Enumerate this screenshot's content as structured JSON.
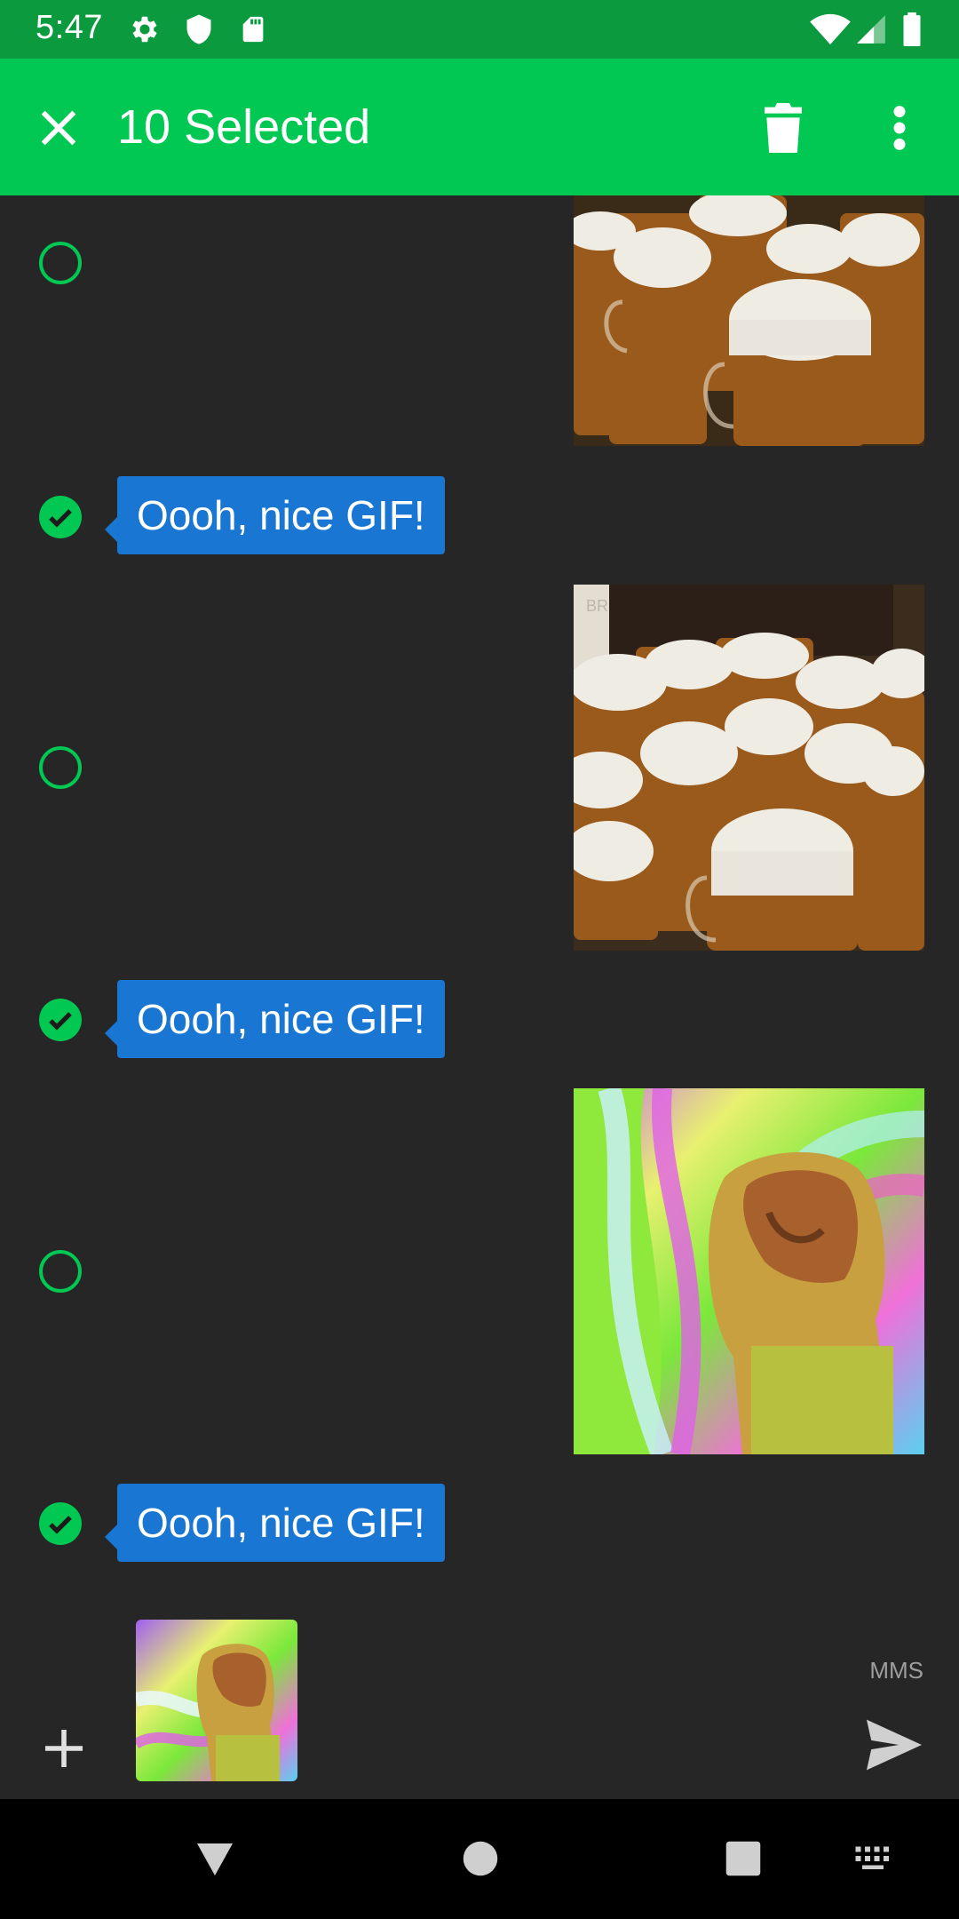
{
  "status_bar": {
    "time": "5:47",
    "icons": [
      "settings-gear-icon",
      "shield-icon",
      "sd-card-icon",
      "wifi-icon",
      "cellular-signal-icon",
      "battery-icon"
    ]
  },
  "toolbar": {
    "close_icon": "close-icon",
    "title": "10 Selected",
    "delete_icon": "trash-icon",
    "more_icon": "more-vert-icon"
  },
  "messages": [
    {
      "type": "image",
      "subject": "beer mugs gif",
      "selected": false
    },
    {
      "type": "text",
      "text": "Oooh, nice GIF!",
      "selected": true
    },
    {
      "type": "image",
      "subject": "beer mugs gif",
      "selected": false
    },
    {
      "type": "text",
      "text": "Oooh, nice GIF!",
      "selected": true
    },
    {
      "type": "image",
      "subject": "psychedelic hand gif",
      "selected": false
    },
    {
      "type": "text",
      "text": "Oooh, nice GIF!",
      "selected": true
    }
  ],
  "composer": {
    "add_icon": "plus-icon",
    "attachment": "psychedelic hand gif thumbnail",
    "mode_label": "MMS",
    "send_icon": "send-icon"
  },
  "nav_bar": {
    "icons": [
      "back-triangle-icon",
      "home-circle-icon",
      "recents-square-icon",
      "keyboard-icon"
    ]
  },
  "colors": {
    "status_bar": "#0c9a3f",
    "app_bar": "#00c853",
    "background": "#262626",
    "bubble": "#1976d2",
    "check": "#00c853"
  }
}
